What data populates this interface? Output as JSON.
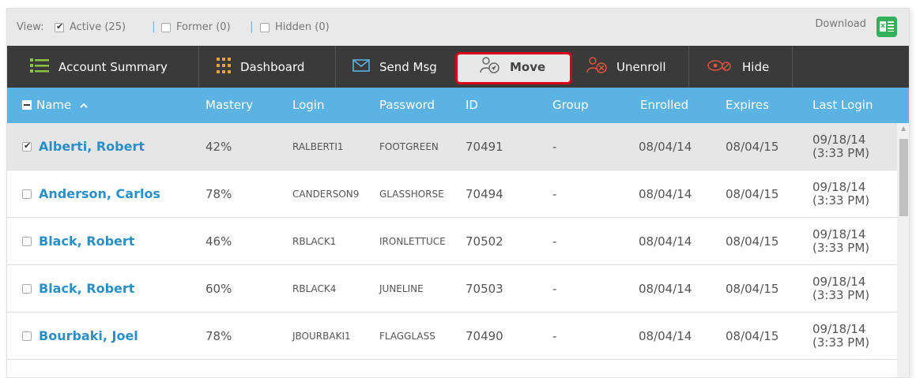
{
  "viewbar": {
    "view_label": "View:",
    "active_label": "Active (25)",
    "former_label": "Former (0)",
    "hidden_label": "Hidden (0)",
    "separator": "|",
    "download_label": "Download",
    "excel_letter": "x"
  },
  "toolbar": {
    "account_summary": "Account Summary",
    "dashboard": "Dashboard",
    "send_msg": "Send Msg",
    "move": "Move",
    "unenroll": "Unenroll",
    "hide": "Hide",
    "highlight_color": "#d9001b"
  },
  "table": {
    "columns": [
      "Name",
      "Mastery",
      "Login",
      "Password",
      "ID",
      "Group",
      "Enrolled",
      "Expires",
      "Last Login"
    ],
    "sort_indicator": "^",
    "rows": [
      {
        "name": "Alberti, Robert",
        "mastery": "42%",
        "login": "RALBERTI1",
        "password": "FOOTGREEN",
        "id": "70491",
        "group": "-",
        "enrolled": "08/04/14",
        "expires": "08/04/15",
        "last_login_date": "09/18/14",
        "last_login_time": "(3:33 PM)",
        "selected": true
      },
      {
        "name": "Anderson, Carlos",
        "mastery": "78%",
        "login": "CANDERSON9",
        "password": "GLASSHORSE",
        "id": "70494",
        "group": "-",
        "enrolled": "08/04/14",
        "expires": "08/04/15",
        "last_login_date": "09/18/14",
        "last_login_time": "(3:33 PM)",
        "selected": false
      },
      {
        "name": "Black, Robert",
        "mastery": "46%",
        "login": "RBLACK1",
        "password": "IRONLETTUCE",
        "id": "70502",
        "group": "-",
        "enrolled": "08/04/14",
        "expires": "08/04/15",
        "last_login_date": "09/18/14",
        "last_login_time": "(3:33 PM)",
        "selected": false
      },
      {
        "name": "Black, Robert",
        "mastery": "60%",
        "login": "RBLACK4",
        "password": "JUNELINE",
        "id": "70503",
        "group": "-",
        "enrolled": "08/04/14",
        "expires": "08/04/15",
        "last_login_date": "09/18/14",
        "last_login_time": "(3:33 PM)",
        "selected": false
      },
      {
        "name": "Bourbaki, Joel",
        "mastery": "78%",
        "login": "JBOURBAKI1",
        "password": "FLAGGLASS",
        "id": "70490",
        "group": "-",
        "enrolled": "08/04/14",
        "expires": "08/04/15",
        "last_login_date": "09/18/14",
        "last_login_time": "(3:33 PM)",
        "selected": false
      }
    ]
  },
  "colors": {
    "header_blue": "#5ab3e2",
    "toolbar_dark": "#3a3a3a",
    "link_blue": "#2a8fc6",
    "excel_green": "#32b15a"
  }
}
